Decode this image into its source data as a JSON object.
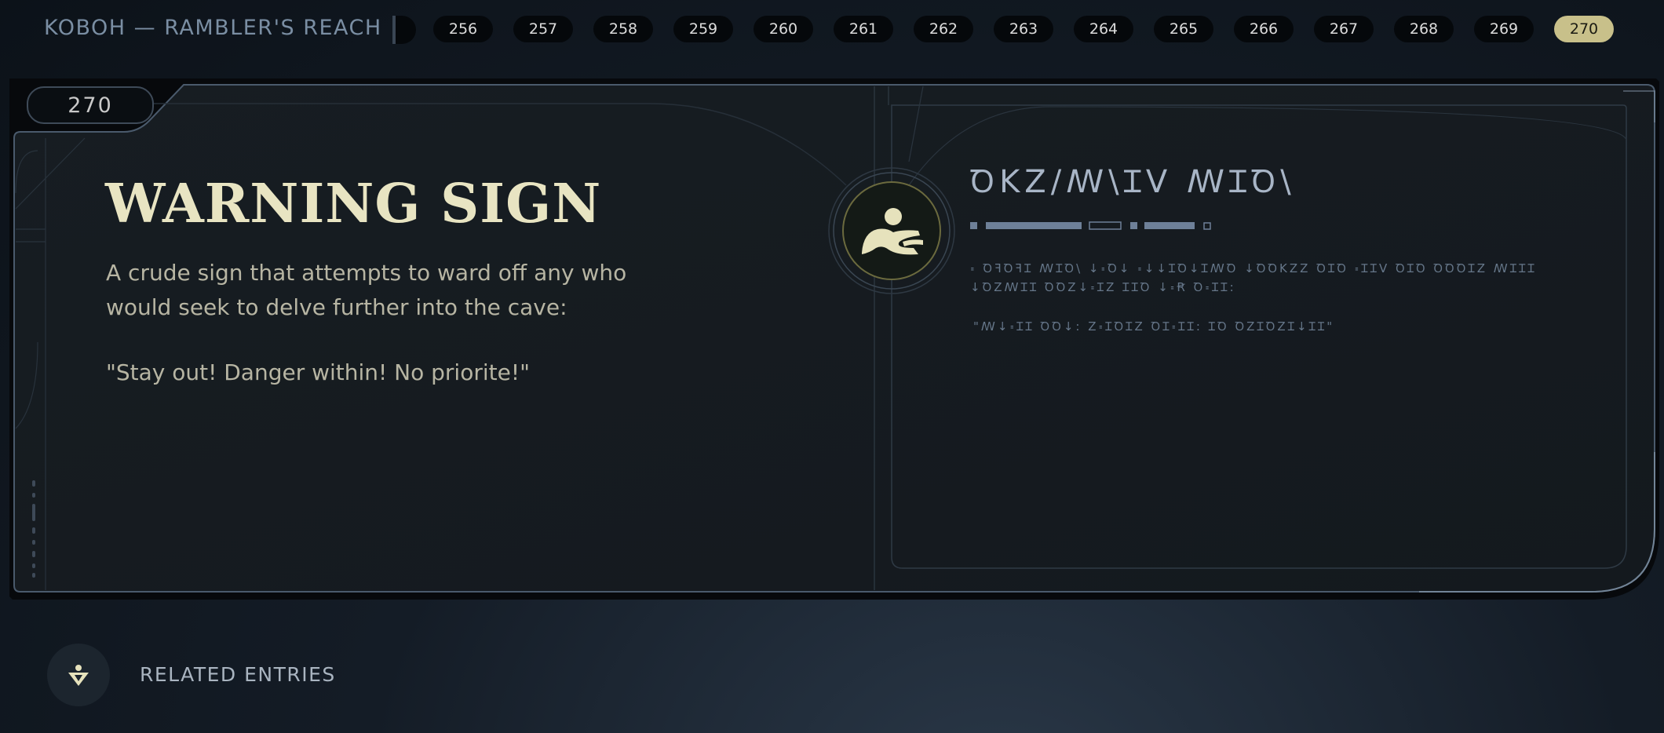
{
  "header": {
    "breadcrumb": "KOBOH — RAMBLER'S REACH",
    "pages": [
      "256",
      "257",
      "258",
      "259",
      "260",
      "261",
      "262",
      "263",
      "264",
      "265",
      "266",
      "267",
      "268",
      "269",
      "270"
    ],
    "active_page": "270"
  },
  "entry": {
    "number": "270",
    "title": "WARNING SIGN",
    "description": "A crude sign that attempts to ward off any who would seek to delve further into the cave:",
    "quote": "\"Stay out! Danger within! No priorite!\"",
    "emblem_icon": "sign-figure-icon",
    "aurebesh_title": "ꝹKZ/ꟿ\\ꞮV ꟿꞮꝹ\\",
    "aurebesh_body": "꞊ ꝹꟻꝹꟻꞮ ꟿꞮꝹ\\ ↓꞊Ꝺ↓ ꞊↓↓ꞮꝹ↓ꞮꟿꝹ ↓ꝹꝹKZZ ꝹꞮꝹ ꞊ꞮꞮV ꝹꞮꝹ ꝹꝹꝹꞮZ ꟿꞮꞮꞮ ↓ꝹZꟿꞮꞮ ꝹꝹZ↓꞊ꞮZ ꞮꞮꝹ ↓꞊Ꞧ Ꝺ꞊ꞮꞮ:",
    "aurebesh_quote": "\"ꟿ↓꞊ꞮꞮ ꝹꝹ↓: Z꞊ꞮꝹꞮZ ꝹꞮ꞊ꞮꞮ: ꞮꝹ ꝹZꞮꝹZꞮ↓ꞮꞮ\""
  },
  "footer": {
    "related_label": "RELATED ENTRIES",
    "related_icon": "holocron-figure-icon"
  },
  "colors": {
    "accent": "#c8c08a",
    "title": "#e8e4c2",
    "frame": "#3e4a58"
  }
}
